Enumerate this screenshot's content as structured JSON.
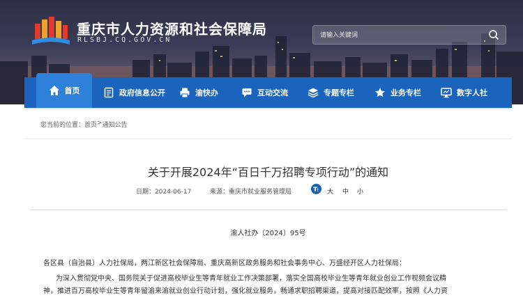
{
  "header": {
    "site_title": "重庆市人力资源和社会保障局",
    "site_domain": "RLSBJ.CQ.GOV.CN",
    "search_placeholder": "请输入关键词"
  },
  "nav": {
    "items": [
      {
        "label": "首页",
        "icon": "home-icon",
        "active": true
      },
      {
        "label": "政府信息公开",
        "icon": "document-icon"
      },
      {
        "label": "渝快办",
        "icon": "printer-icon"
      },
      {
        "label": "互动交流",
        "icon": "chat-icon"
      },
      {
        "label": "专题专栏",
        "icon": "layers-icon"
      },
      {
        "label": "业务专栏",
        "icon": "star-icon"
      },
      {
        "label": "数字人社",
        "icon": "monitor-icon"
      }
    ]
  },
  "breadcrumb": {
    "prefix": "您当前的位置：",
    "home": "首页",
    "separator": ">",
    "current": "通知公告"
  },
  "article": {
    "title": "关于开展2024年“百日千万招聘专项行动”的通知",
    "date_label": "日期：",
    "date": "2024-06-17",
    "source_label": "来源：",
    "source": "重庆市就业服务管理局",
    "font_sizes": [
      "大",
      "中",
      "小"
    ],
    "doc_number": "渝人社办〔2024〕95号",
    "recipients": "各区县（自治县）人力社保局，两江新区社会保障局、重庆高新区政务服务和社会事务中心、万盛经开区人力社保局：",
    "body_line1": "为深入贯彻党中央、国务院关于促进高校毕业生等青年就业工作决策部署，落实全国高校毕业生等青年就业创业工作视频会议精",
    "body_line2": "神，推进百万高校毕业生等青年留渝来渝就业创业行动计划，强化就业服务，畅通求职招聘渠道，提高对接匹配效率，按照《人力资"
  },
  "colors": {
    "nav_bg": "#1b64bd",
    "nav_active": "#2f80d8",
    "font_icon": "#1b5fae"
  }
}
